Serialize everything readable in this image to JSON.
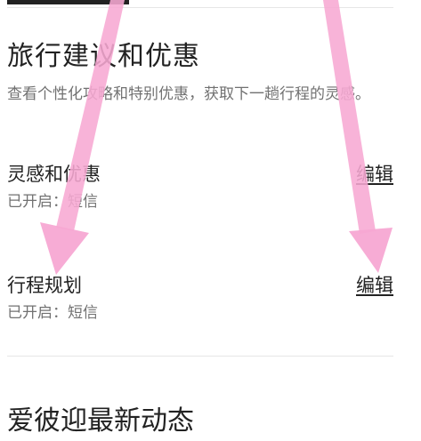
{
  "section": {
    "title": "旅行建议和优惠",
    "description": "查看个性化攻略和特别优惠，获取下一趟行程的灵感。"
  },
  "settings": [
    {
      "label": "灵感和优惠",
      "status": "已开启：短信",
      "edit_label": "编辑"
    },
    {
      "label": "行程规划",
      "status": "已开启：短信",
      "edit_label": "编辑"
    }
  ],
  "next_section": {
    "title": "爱彼迎最新动态"
  },
  "colors": {
    "annotation_arrow": "#F7A8D3",
    "primary_text": "#222222",
    "secondary_text": "#717171",
    "divider": "#E6E6E6"
  }
}
